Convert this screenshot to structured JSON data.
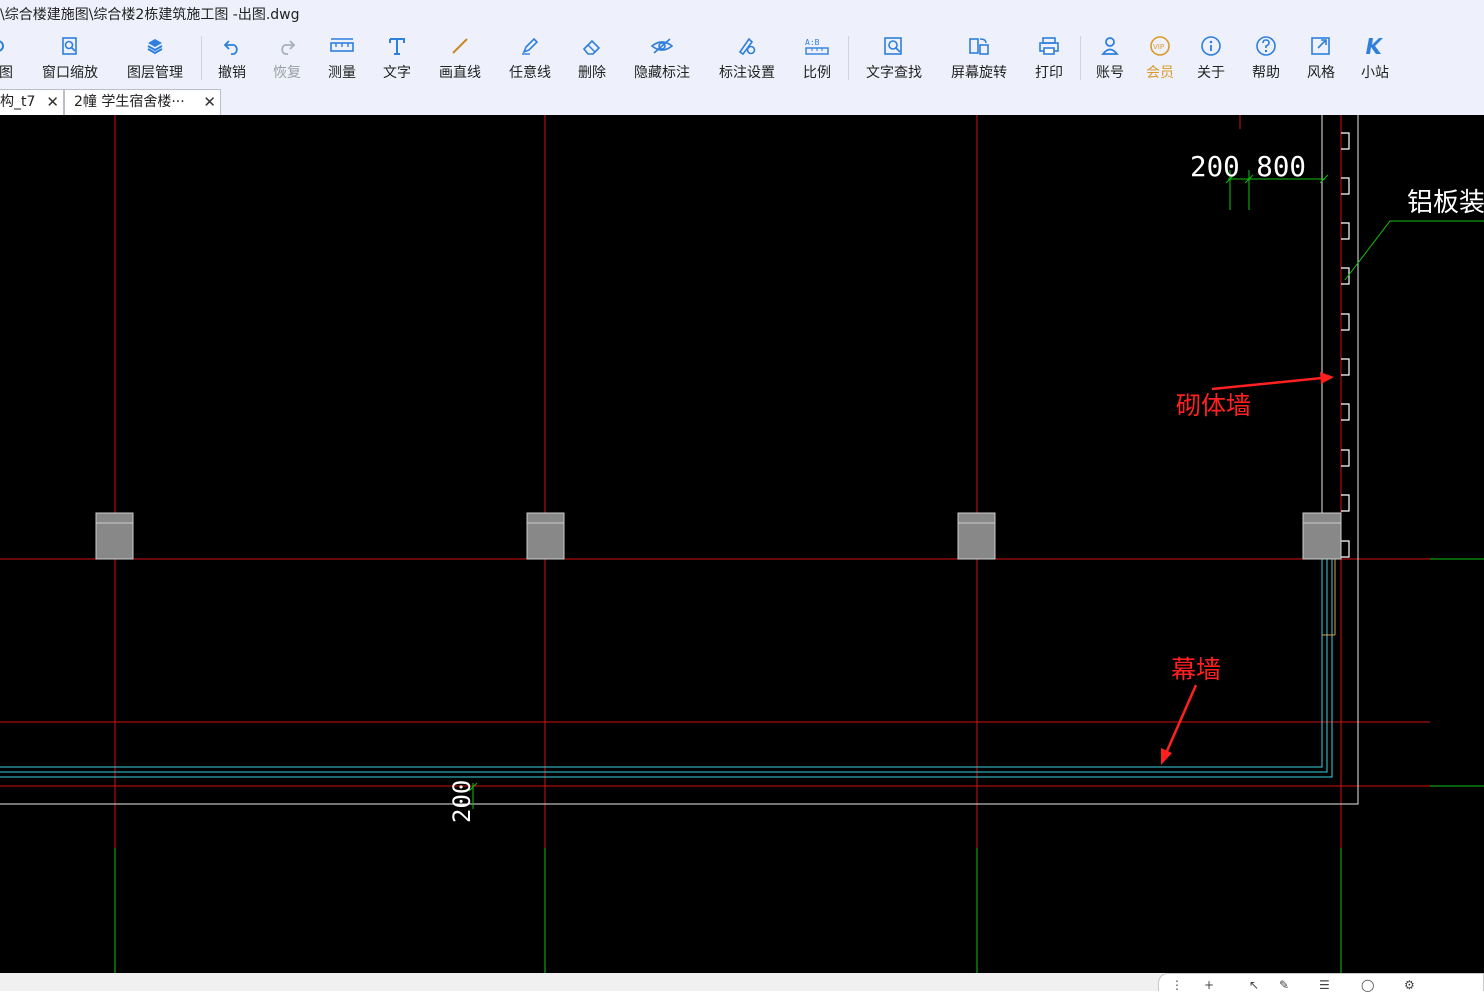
{
  "window": {
    "title": "\\综合楼建施图\\综合楼2栋建筑施工图 -出图.dwg"
  },
  "toolbar": {
    "items": [
      {
        "label": "图",
        "icon": "drawing-icon"
      },
      {
        "label": "窗口缩放",
        "icon": "window-zoom-icon"
      },
      {
        "label": "图层管理",
        "icon": "layers-icon"
      },
      {
        "label": "撤销",
        "icon": "undo-icon"
      },
      {
        "label": "恢复",
        "icon": "redo-icon"
      },
      {
        "label": "测量",
        "icon": "ruler-icon"
      },
      {
        "label": "文字",
        "icon": "text-icon"
      },
      {
        "label": "画直线",
        "icon": "line-icon"
      },
      {
        "label": "任意线",
        "icon": "pen-icon"
      },
      {
        "label": "删除",
        "icon": "eraser-icon"
      },
      {
        "label": "隐藏标注",
        "icon": "eye-hide-icon"
      },
      {
        "label": "标注设置",
        "icon": "annotation-settings-icon"
      },
      {
        "label": "比例",
        "icon": "scale-icon"
      },
      {
        "label": "文字查找",
        "icon": "text-search-icon"
      },
      {
        "label": "屏幕旋转",
        "icon": "screen-rotate-icon"
      },
      {
        "label": "打印",
        "icon": "print-icon"
      },
      {
        "label": "账号",
        "icon": "user-icon"
      },
      {
        "label": "会员",
        "icon": "vip-icon"
      },
      {
        "label": "关于",
        "icon": "info-icon"
      },
      {
        "label": "帮助",
        "icon": "help-icon"
      },
      {
        "label": "风格",
        "icon": "style-icon"
      },
      {
        "label": "小站",
        "icon": "station-icon"
      }
    ]
  },
  "tabs": [
    {
      "label": "构_t7",
      "close": "✕"
    },
    {
      "label": "2幢  学生宿舍楼···",
      "close": "✕"
    }
  ],
  "drawing": {
    "dim_top": "200  800",
    "dim_bottom": "200",
    "label_aluminum": "铝板装饰",
    "label_masonry": "砌体墙",
    "label_curtain": "幕墙"
  },
  "colors": {
    "canvas": "#000000",
    "axis": "#d01010",
    "green": "#10c010",
    "cyan": "#40d0e0",
    "annotation": "#ff2020",
    "column": "#888888",
    "ui_blue": "#2f7fdc",
    "vip": "#d99a2b"
  }
}
